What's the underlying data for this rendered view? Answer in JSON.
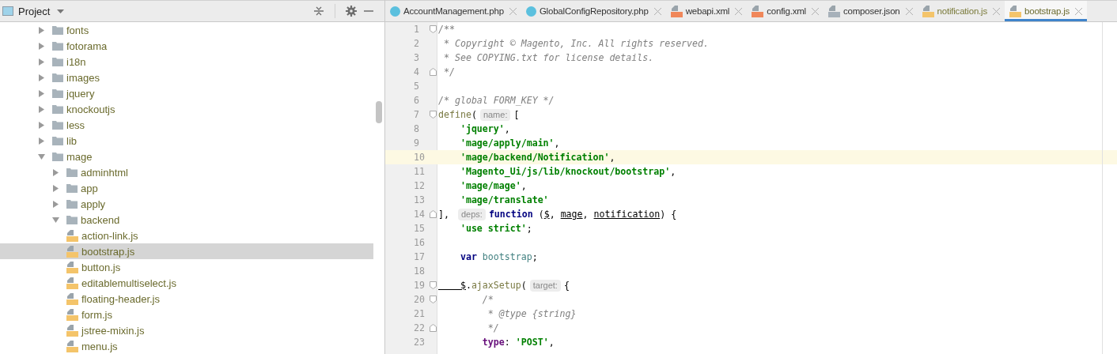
{
  "project_panel": {
    "title": "Project",
    "tree": [
      {
        "label": "fonts",
        "kind": "folder",
        "expanded": false,
        "selected": false
      },
      {
        "label": "fotorama",
        "kind": "folder",
        "expanded": false,
        "selected": false
      },
      {
        "label": "i18n",
        "kind": "folder",
        "expanded": false,
        "selected": false
      },
      {
        "label": "images",
        "kind": "folder",
        "expanded": false,
        "selected": false
      },
      {
        "label": "jquery",
        "kind": "folder",
        "expanded": false,
        "selected": false
      },
      {
        "label": "knockoutjs",
        "kind": "folder",
        "expanded": false,
        "selected": false
      },
      {
        "label": "less",
        "kind": "folder",
        "expanded": false,
        "selected": false
      },
      {
        "label": "lib",
        "kind": "folder",
        "expanded": false,
        "selected": false
      },
      {
        "label": "mage",
        "kind": "folder",
        "expanded": true,
        "selected": false,
        "children": [
          {
            "label": "adminhtml",
            "kind": "folder",
            "expanded": false,
            "selected": false
          },
          {
            "label": "app",
            "kind": "folder",
            "expanded": false,
            "selected": false
          },
          {
            "label": "apply",
            "kind": "folder",
            "expanded": false,
            "selected": false
          },
          {
            "label": "backend",
            "kind": "folder",
            "expanded": true,
            "selected": false,
            "children": [
              {
                "label": "action-link.js",
                "kind": "file",
                "selected": false
              },
              {
                "label": "bootstrap.js",
                "kind": "file",
                "selected": true
              },
              {
                "label": "button.js",
                "kind": "file",
                "selected": false
              },
              {
                "label": "editablemultiselect.js",
                "kind": "file",
                "selected": false
              },
              {
                "label": "floating-header.js",
                "kind": "file",
                "selected": false
              },
              {
                "label": "form.js",
                "kind": "file",
                "selected": false
              },
              {
                "label": "jstree-mixin.js",
                "kind": "file",
                "selected": false
              },
              {
                "label": "menu.js",
                "kind": "file",
                "selected": false
              }
            ]
          }
        ]
      }
    ]
  },
  "tabs": [
    {
      "label": "AccountManagement.php",
      "kind": "class",
      "color": "#333333",
      "selected": false
    },
    {
      "label": "GlobalConfigRepository.php",
      "kind": "class",
      "color": "#333333",
      "selected": false
    },
    {
      "label": "webapi.xml",
      "kind": "xml",
      "color": "#333333",
      "selected": false
    },
    {
      "label": "config.xml",
      "kind": "xml",
      "color": "#333333",
      "selected": false
    },
    {
      "label": "composer.json",
      "kind": "json",
      "color": "#333333",
      "selected": false
    },
    {
      "label": "notification.js",
      "kind": "js",
      "color": "#7a7a3a",
      "selected": false
    },
    {
      "label": "bootstrap.js",
      "kind": "js",
      "color": "#6b6b2e",
      "selected": true
    }
  ],
  "editor": {
    "lines": [
      {
        "n": "1",
        "marker": {
          "kind": "fold-start"
        },
        "current": false,
        "tokens": [
          {
            "kind": "comment",
            "t": "/**"
          }
        ]
      },
      {
        "n": "2",
        "current": false,
        "tokens": [
          {
            "kind": "comment",
            "t": " * Copyright © Magento, Inc. All rights reserved."
          }
        ]
      },
      {
        "n": "3",
        "current": false,
        "tokens": [
          {
            "kind": "comment",
            "t": " * See COPYING.txt for license details."
          }
        ]
      },
      {
        "n": "4",
        "marker": {
          "kind": "fold-end"
        },
        "current": false,
        "tokens": [
          {
            "kind": "comment",
            "t": " */"
          }
        ]
      },
      {
        "n": "5",
        "current": false
      },
      {
        "n": "6",
        "current": false,
        "tokens": [
          {
            "kind": "comment",
            "t": "/* global FORM_KEY */"
          }
        ]
      },
      {
        "n": "7",
        "marker": {
          "kind": "fold-start"
        },
        "current": false,
        "tokens": [
          {
            "kind": "call",
            "t": "define"
          },
          {
            "kind": "plain",
            "t": "("
          },
          {
            "kind": "hint",
            "t": "name:"
          },
          {
            "kind": "plain",
            "t": "["
          }
        ]
      },
      {
        "n": "8",
        "current": false,
        "tokens": [
          {
            "kind": "string",
            "t": "    'jquery'"
          },
          {
            "kind": "plain",
            "t": ","
          }
        ]
      },
      {
        "n": "9",
        "current": false,
        "tokens": [
          {
            "kind": "string",
            "t": "    'mage/apply/main'"
          },
          {
            "kind": "plain",
            "t": ","
          }
        ]
      },
      {
        "n": "10",
        "current": true,
        "tokens": [
          {
            "kind": "string",
            "t": "    'mage/backend/Notification'"
          },
          {
            "kind": "plain",
            "t": ","
          }
        ]
      },
      {
        "n": "11",
        "current": false,
        "tokens": [
          {
            "kind": "string",
            "t": "    'Magento_Ui/js/lib/knockout/bootstrap'"
          },
          {
            "kind": "plain",
            "t": ","
          }
        ]
      },
      {
        "n": "12",
        "current": false,
        "tokens": [
          {
            "kind": "string",
            "t": "    'mage/mage'"
          },
          {
            "kind": "plain",
            "t": ","
          }
        ]
      },
      {
        "n": "13",
        "current": false,
        "tokens": [
          {
            "kind": "string",
            "t": "    'mage/translate'"
          }
        ]
      },
      {
        "n": "14",
        "marker": {
          "kind": "fold-end"
        },
        "current": false,
        "tokens": [
          {
            "kind": "plain",
            "t": "], "
          },
          {
            "kind": "hint",
            "t": "deps:"
          },
          {
            "kind": "keyword",
            "t": "function"
          },
          {
            "kind": "plain",
            "t": " ("
          },
          {
            "kind": "param",
            "t": "$"
          },
          {
            "kind": "plain",
            "t": ", "
          },
          {
            "kind": "param",
            "t": "mage"
          },
          {
            "kind": "plain",
            "t": ", "
          },
          {
            "kind": "param",
            "t": "notification"
          },
          {
            "kind": "plain",
            "t": ") {"
          }
        ]
      },
      {
        "n": "15",
        "current": false,
        "tokens": [
          {
            "kind": "string",
            "t": "    'use strict'"
          },
          {
            "kind": "plain",
            "t": ";"
          }
        ]
      },
      {
        "n": "16",
        "current": false
      },
      {
        "n": "17",
        "current": false,
        "tokens": [
          {
            "kind": "keyword",
            "t": "    var"
          },
          {
            "kind": "ident",
            "t": " bootstrap"
          },
          {
            "kind": "plain",
            "t": ";"
          }
        ]
      },
      {
        "n": "18",
        "current": false
      },
      {
        "n": "19",
        "marker": {
          "kind": "fold-start"
        },
        "current": false,
        "tokens": [
          {
            "kind": "param",
            "t": "    $"
          },
          {
            "kind": "plain",
            "t": "."
          },
          {
            "kind": "call",
            "t": "ajaxSetup"
          },
          {
            "kind": "plain",
            "t": "("
          },
          {
            "kind": "hint",
            "t": "target:"
          },
          {
            "kind": "plain",
            "t": "{"
          }
        ]
      },
      {
        "n": "20",
        "marker": {
          "kind": "fold-start"
        },
        "current": false,
        "tokens": [
          {
            "kind": "comment",
            "t": "        /*"
          }
        ]
      },
      {
        "n": "21",
        "current": false,
        "tokens": [
          {
            "kind": "comment",
            "t": "         * @type {string}"
          }
        ]
      },
      {
        "n": "22",
        "marker": {
          "kind": "fold-end"
        },
        "current": false,
        "tokens": [
          {
            "kind": "comment",
            "t": "         */"
          }
        ]
      },
      {
        "n": "23",
        "current": false,
        "tokens": [
          {
            "kind": "property",
            "t": "        type"
          },
          {
            "kind": "plain",
            "t": ": "
          },
          {
            "kind": "string",
            "t": "'POST'"
          },
          {
            "kind": "plain",
            "t": ","
          }
        ]
      }
    ]
  }
}
